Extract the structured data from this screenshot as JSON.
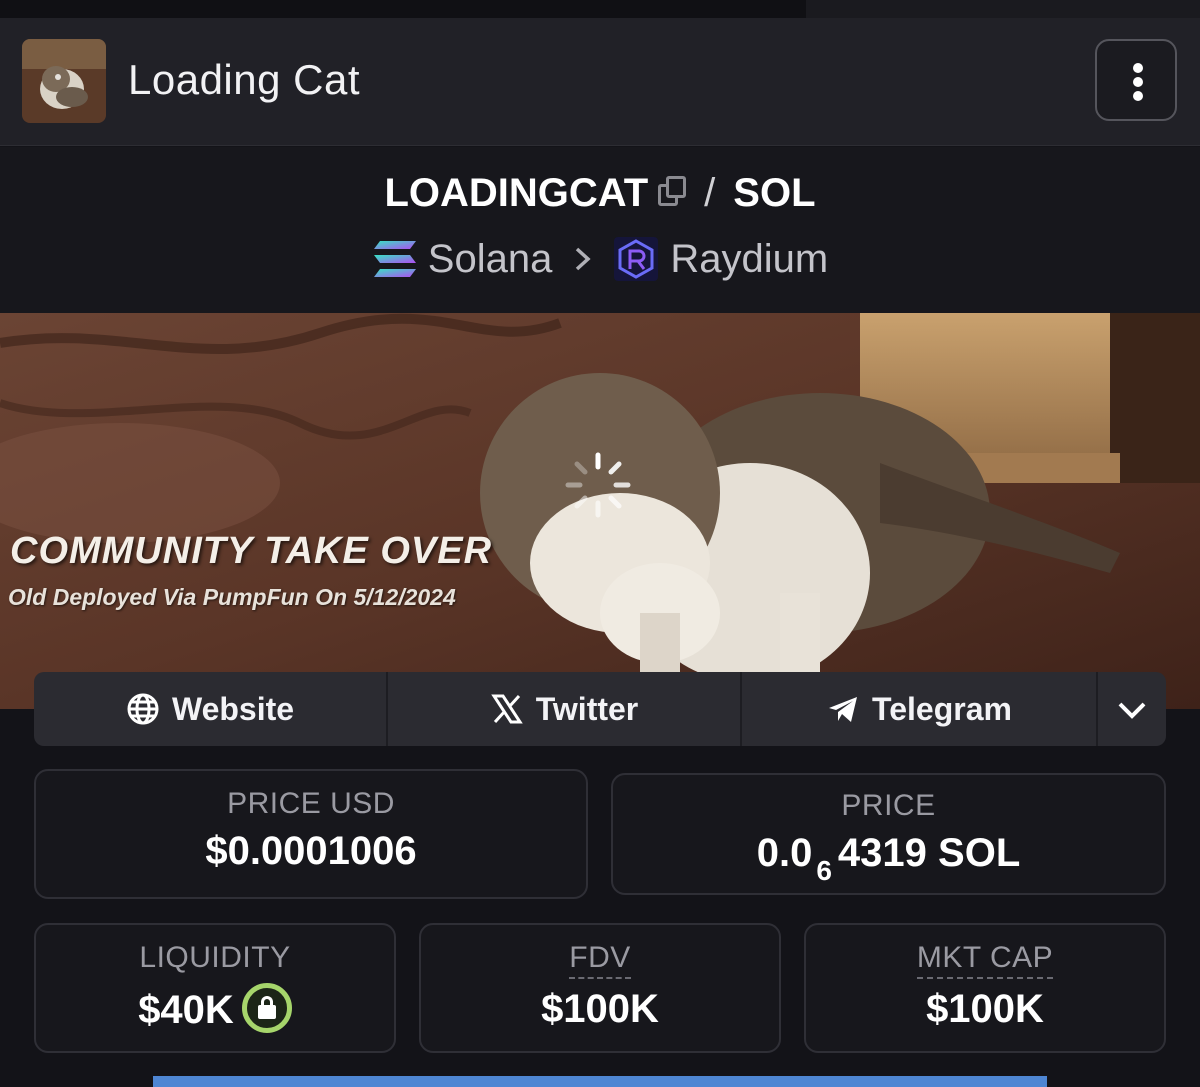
{
  "header": {
    "title": "Loading Cat",
    "menu_icon": "kebab-menu-icon"
  },
  "pair": {
    "base": "LOADINGCAT",
    "separator": "/",
    "quote": "SOL",
    "chain": "Solana",
    "dex": "Raydium"
  },
  "banner": {
    "headline": "COMMUNITY TAKE OVER",
    "subline": "Old Deployed Via PumpFun On 5/12/2024"
  },
  "links": {
    "website": "Website",
    "twitter": "Twitter",
    "telegram": "Telegram"
  },
  "stats": {
    "price_usd_label": "PRICE USD",
    "price_usd_value": "$0.0001006",
    "price_label": "PRICE",
    "price_prefix": "0.0",
    "price_zeros": "6",
    "price_digits": "4319",
    "price_unit": "SOL",
    "liquidity_label": "LIQUIDITY",
    "liquidity_value": "$40K",
    "fdv_label": "FDV",
    "fdv_value": "$100K",
    "mktcap_label": "MKT CAP",
    "mktcap_value": "$100K"
  },
  "colors": {
    "background": "#131318",
    "header": "#212127",
    "card_border": "#2f2f36",
    "lock_green": "#a6d56b",
    "bottom_bar": "#4e86d3"
  }
}
